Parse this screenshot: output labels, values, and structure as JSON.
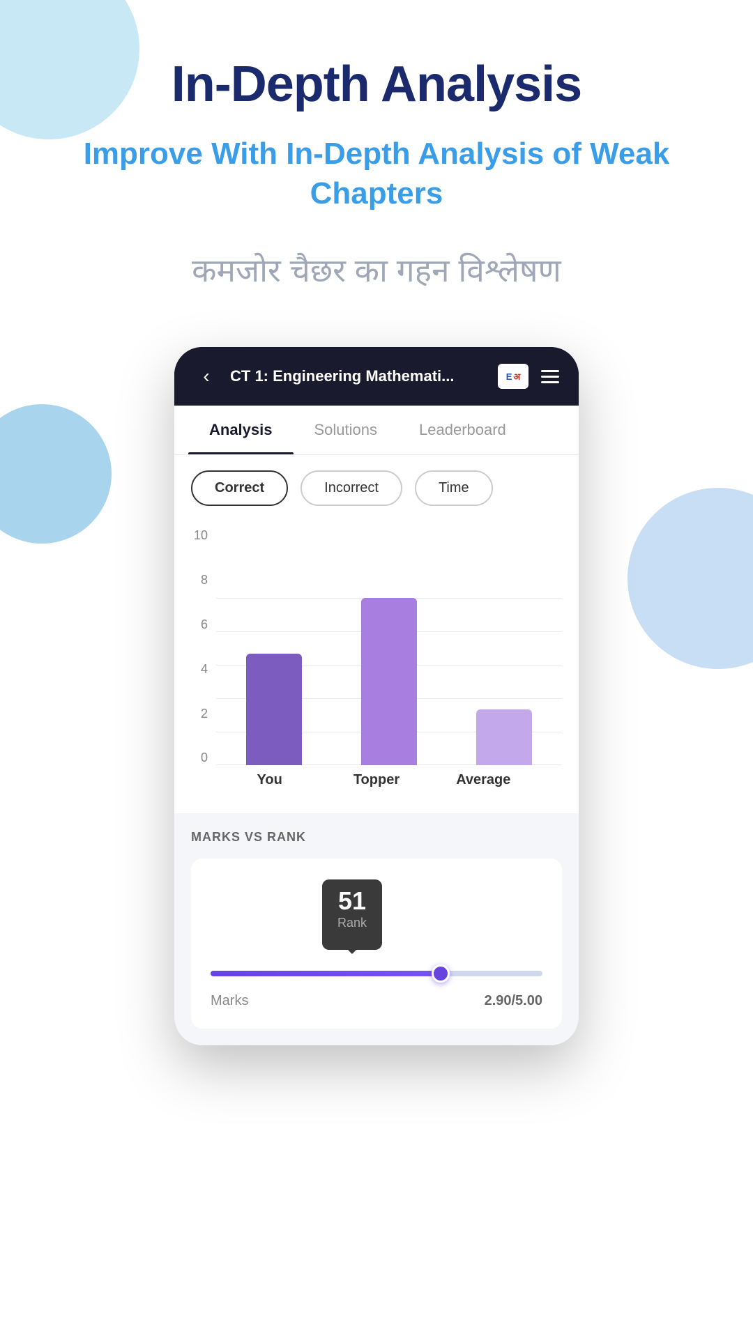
{
  "page": {
    "main_title": "In-Depth Analysis",
    "subtitle": "Improve With In-Depth Analysis of Weak Chapters",
    "hindi_text": "कमजोर चैछर का गहन विश्लेषण"
  },
  "phone": {
    "header": {
      "title": "CT 1: Engineering Mathemati...",
      "back_icon": "‹",
      "edu_icon_text": "E अ",
      "menu_aria": "menu"
    },
    "tabs": [
      {
        "label": "Analysis",
        "active": true
      },
      {
        "label": "Solutions",
        "active": false
      },
      {
        "label": "Leaderboard",
        "active": false
      }
    ],
    "filters": [
      {
        "label": "Correct",
        "active": true
      },
      {
        "label": "Incorrect",
        "active": false
      },
      {
        "label": "Time",
        "active": false
      }
    ],
    "chart": {
      "y_labels": [
        "0",
        "2",
        "4",
        "6",
        "8",
        "10"
      ],
      "bars": [
        {
          "key": "you",
          "label": "You",
          "height_pct": 35
        },
        {
          "key": "topper",
          "label": "Topper",
          "height_pct": 55
        },
        {
          "key": "average",
          "label": "Average",
          "height_pct": 18
        }
      ]
    },
    "marks_rank": {
      "section_title": "MARKS VS RANK",
      "rank_number": "51",
      "rank_label": "Rank",
      "marks_label": "Marks",
      "marks_value": "2.90/5.00",
      "slider_fill_pct": 72
    }
  }
}
